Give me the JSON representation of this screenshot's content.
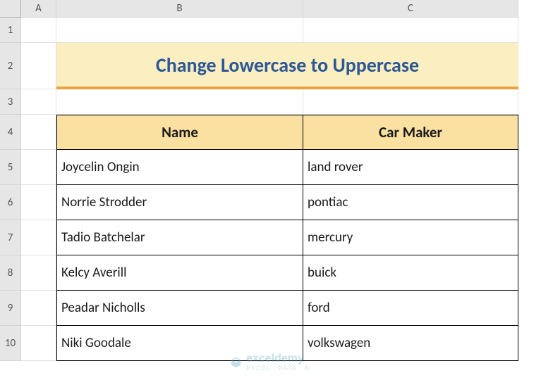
{
  "columns": [
    "",
    "A",
    "B",
    "C"
  ],
  "rows": [
    "1",
    "2",
    "3",
    "4",
    "5",
    "6",
    "7",
    "8",
    "9",
    "10"
  ],
  "title": "Change Lowercase to Uppercase",
  "headers": {
    "name": "Name",
    "car": "Car Maker"
  },
  "data": [
    {
      "name": "Joycelin Ongin",
      "car": "land rover"
    },
    {
      "name": "Norrie Strodder",
      "car": "pontiac"
    },
    {
      "name": "Tadio Batchelar",
      "car": "mercury"
    },
    {
      "name": "Kelcy Averill",
      "car": "buick"
    },
    {
      "name": "Peadar Nicholls",
      "car": "ford"
    },
    {
      "name": "Niki Goodale",
      "car": "volkswagen"
    }
  ],
  "watermark": {
    "brand": "exceldemy",
    "sub": "EXCEL · DATA · BI"
  },
  "chart_data": {
    "type": "table",
    "title": "Change Lowercase to Uppercase",
    "columns": [
      "Name",
      "Car Maker"
    ],
    "rows": [
      [
        "Joycelin Ongin",
        "land rover"
      ],
      [
        "Norrie Strodder",
        "pontiac"
      ],
      [
        "Tadio Batchelar",
        "mercury"
      ],
      [
        "Kelcy Averill",
        "buick"
      ],
      [
        "Peadar Nicholls",
        "ford"
      ],
      [
        "Niki Goodale",
        "volkswagen"
      ]
    ]
  }
}
